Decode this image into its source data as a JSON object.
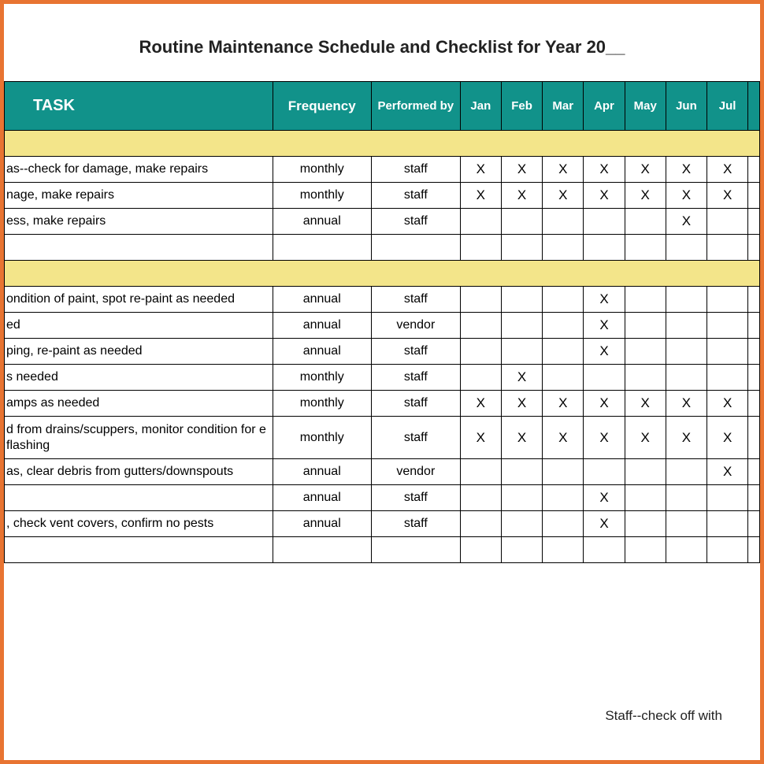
{
  "title": "Routine Maintenance Schedule and Checklist for Year 20__",
  "headers": {
    "task": "TASK",
    "frequency": "Frequency",
    "performed_by": "Performed by",
    "months": [
      "Jan",
      "Feb",
      "Mar",
      "Apr",
      "May",
      "Jun",
      "Jul"
    ]
  },
  "footer_note": "Staff--check off with",
  "rows": [
    {
      "type": "section"
    },
    {
      "type": "data",
      "task": "as--check for damage, make repairs",
      "freq": "monthly",
      "perf": "staff",
      "marks": [
        "X",
        "X",
        "X",
        "X",
        "X",
        "X",
        "X"
      ]
    },
    {
      "type": "data",
      "task": "nage, make repairs",
      "freq": "monthly",
      "perf": "staff",
      "marks": [
        "X",
        "X",
        "X",
        "X",
        "X",
        "X",
        "X"
      ]
    },
    {
      "type": "data",
      "task": "ess, make repairs",
      "freq": "annual",
      "perf": "staff",
      "marks": [
        "",
        "",
        "",
        "",
        "",
        "X",
        ""
      ]
    },
    {
      "type": "blank"
    },
    {
      "type": "section"
    },
    {
      "type": "data",
      "task": "ondition of paint, spot re-paint as needed",
      "freq": "annual",
      "perf": "staff",
      "marks": [
        "",
        "",
        "",
        "X",
        "",
        "",
        ""
      ]
    },
    {
      "type": "data",
      "task": "ed",
      "freq": "annual",
      "perf": "vendor",
      "marks": [
        "",
        "",
        "",
        "X",
        "",
        "",
        ""
      ]
    },
    {
      "type": "data",
      "task": "ping, re-paint as needed",
      "freq": "annual",
      "perf": "staff",
      "marks": [
        "",
        "",
        "",
        "X",
        "",
        "",
        ""
      ]
    },
    {
      "type": "data",
      "task": "s needed",
      "freq": "monthly",
      "perf": "staff",
      "marks": [
        "",
        "X",
        "",
        "",
        "",
        "",
        ""
      ]
    },
    {
      "type": "data",
      "task": "amps as needed",
      "freq": "monthly",
      "perf": "staff",
      "marks": [
        "X",
        "X",
        "X",
        "X",
        "X",
        "X",
        "X"
      ]
    },
    {
      "type": "data",
      "double": true,
      "task": "d from drains/scuppers, monitor condition for e flashing",
      "freq": "monthly",
      "perf": "staff",
      "marks": [
        "X",
        "X",
        "X",
        "X",
        "X",
        "X",
        "X"
      ]
    },
    {
      "type": "data",
      "task": "as, clear debris from gutters/downspouts",
      "freq": "annual",
      "perf": "vendor",
      "marks": [
        "",
        "",
        "",
        "",
        "",
        "",
        "X"
      ]
    },
    {
      "type": "data",
      "task": "",
      "freq": "annual",
      "perf": "staff",
      "marks": [
        "",
        "",
        "",
        "X",
        "",
        "",
        ""
      ]
    },
    {
      "type": "data",
      "task": ", check vent covers, confirm no pests",
      "freq": "annual",
      "perf": "staff",
      "marks": [
        "",
        "",
        "",
        "X",
        "",
        "",
        ""
      ]
    },
    {
      "type": "blank"
    }
  ],
  "chart_data": {
    "type": "table",
    "title": "Routine Maintenance Schedule and Checklist for Year 20__",
    "columns": [
      "TASK",
      "Frequency",
      "Performed by",
      "Jan",
      "Feb",
      "Mar",
      "Apr",
      "May",
      "Jun",
      "Jul"
    ],
    "rows": [
      [
        "as--check for damage, make repairs",
        "monthly",
        "staff",
        "X",
        "X",
        "X",
        "X",
        "X",
        "X",
        "X"
      ],
      [
        "nage, make repairs",
        "monthly",
        "staff",
        "X",
        "X",
        "X",
        "X",
        "X",
        "X",
        "X"
      ],
      [
        "ess, make repairs",
        "annual",
        "staff",
        "",
        "",
        "",
        "",
        "",
        "X",
        ""
      ],
      [
        "ondition of paint, spot re-paint as needed",
        "annual",
        "staff",
        "",
        "",
        "",
        "X",
        "",
        "",
        ""
      ],
      [
        "ed",
        "annual",
        "vendor",
        "",
        "",
        "",
        "X",
        "",
        "",
        ""
      ],
      [
        "ping, re-paint as needed",
        "annual",
        "staff",
        "",
        "",
        "",
        "X",
        "",
        "",
        ""
      ],
      [
        "s needed",
        "monthly",
        "staff",
        "",
        "X",
        "",
        "",
        "",
        "",
        ""
      ],
      [
        "amps as needed",
        "monthly",
        "staff",
        "X",
        "X",
        "X",
        "X",
        "X",
        "X",
        "X"
      ],
      [
        "d from drains/scuppers, monitor condition for e flashing",
        "monthly",
        "staff",
        "X",
        "X",
        "X",
        "X",
        "X",
        "X",
        "X"
      ],
      [
        "as, clear debris from gutters/downspouts",
        "annual",
        "vendor",
        "",
        "",
        "",
        "",
        "",
        "",
        "X"
      ],
      [
        "",
        "annual",
        "staff",
        "",
        "",
        "",
        "X",
        "",
        "",
        ""
      ],
      [
        ", check vent covers, confirm no pests",
        "annual",
        "staff",
        "",
        "",
        "",
        "X",
        "",
        "",
        ""
      ]
    ]
  }
}
